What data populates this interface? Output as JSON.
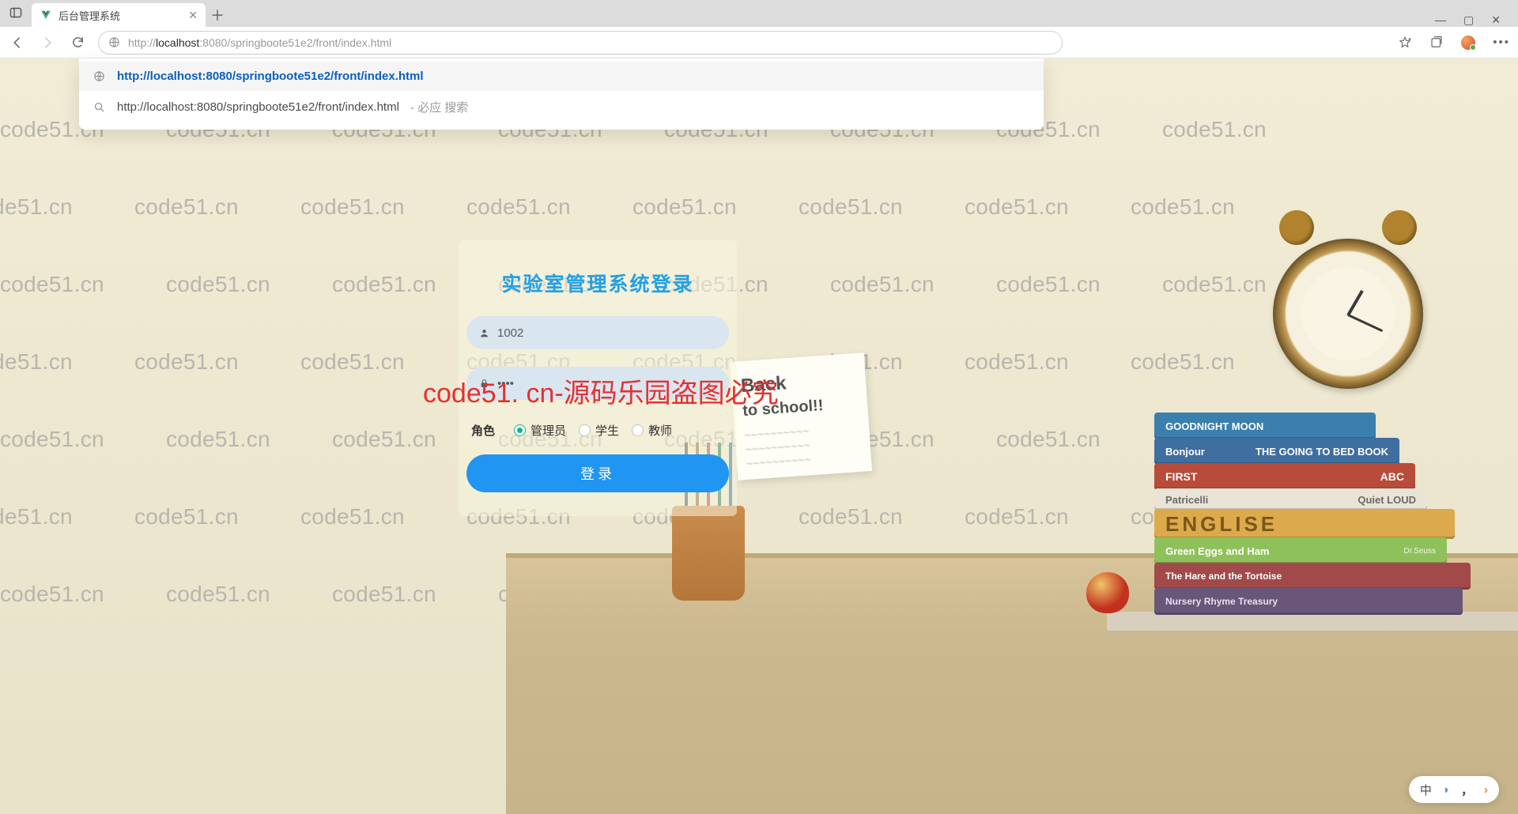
{
  "browser": {
    "tab_title": "后台管理系统",
    "url_protocol": "http://",
    "url_host": "localhost",
    "url_rest": ":8080/springboote51e2/front/index.html",
    "autocomplete": [
      {
        "text": "http://localhost:8080/springboote51e2/front/index.html",
        "suffix": ""
      },
      {
        "text": "http://localhost:8080/springboote51e2/front/index.html",
        "suffix": " - 必应 搜索"
      }
    ]
  },
  "login": {
    "title": "实验室管理系统登录",
    "username_value": "1002",
    "password_value": "••••",
    "role_label": "角色",
    "roles": {
      "r0": "管理员",
      "r1": "学生",
      "r2": "教师"
    },
    "submit_label": "登录"
  },
  "note": {
    "line1": "Back",
    "line2": "to school!!"
  },
  "books": {
    "b0": "GOODNIGHT MOON",
    "b1l": "Bonjour",
    "b1r": "THE GOING TO BED BOOK",
    "b2l": "FIRST",
    "b2r": "ABC",
    "b3l": "Patricelli",
    "b3r": "Quiet LOUD",
    "b4": "ENGLISE",
    "b5l": "Green Eggs and Ham",
    "b5r": "Dr.Seuss",
    "b6": "The Hare and the Tortoise",
    "b7": "Nursery Rhyme Treasury"
  },
  "watermark_text": "code51.cn",
  "watermark_red": "code51. cn-源码乐园盗图必究",
  "ime": {
    "lang": "中"
  }
}
